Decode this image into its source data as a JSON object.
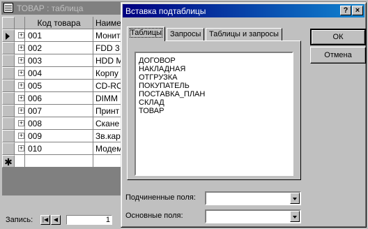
{
  "background_window": {
    "title": "ТОВАР : таблица",
    "column_headers": [
      "Код товара",
      "Наиме"
    ],
    "rows": [
      {
        "code": "001",
        "name": "Монит"
      },
      {
        "code": "002",
        "name": "FDD 3"
      },
      {
        "code": "003",
        "name": "HDD M"
      },
      {
        "code": "004",
        "name": "Корпу"
      },
      {
        "code": "005",
        "name": "CD-RO"
      },
      {
        "code": "006",
        "name": "DIMM"
      },
      {
        "code": "007",
        "name": "Принт"
      },
      {
        "code": "008",
        "name": "Скане"
      },
      {
        "code": "009",
        "name": "Зв.кар"
      },
      {
        "code": "010",
        "name": "Модем"
      }
    ],
    "new_row_marker": "✱",
    "expand_glyph": "+",
    "record_label": "Запись:",
    "record_value": "1"
  },
  "dialog": {
    "title": "Вставка подтаблицы",
    "help_glyph": "?",
    "close_glyph": "×",
    "tabs": [
      "Таблицы",
      "Запросы",
      "Таблицы и запросы"
    ],
    "active_tab": "Таблицы",
    "list_items": [
      "ДОГОВОР",
      "НАКЛАДНАЯ",
      "ОТГРУЗКА",
      "ПОКУПАТЕЛЬ",
      "ПОСТАВКА_ПЛАН",
      "СКЛАД",
      "ТОВАР"
    ],
    "ok_label": "ОК",
    "cancel_label": "Отмена",
    "child_fields_label": "Подчиненные поля:",
    "child_fields_value": "",
    "master_fields_label": "Основные поля:",
    "master_fields_value": ""
  }
}
